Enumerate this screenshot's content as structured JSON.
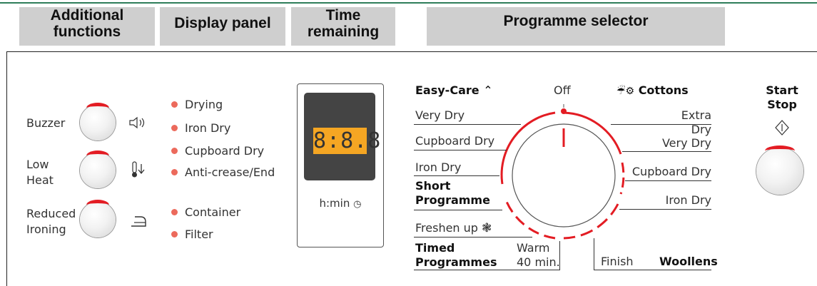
{
  "headers": {
    "additional_functions": [
      "Additional",
      "functions"
    ],
    "display_panel": "Display panel",
    "time_remaining": [
      "Time",
      "remaining"
    ],
    "programme_selector": "Programme selector"
  },
  "functions": [
    {
      "label": [
        "Buzzer"
      ],
      "icon": "speaker-icon"
    },
    {
      "label": [
        "Low",
        "Heat"
      ],
      "icon": "thermometer-down-icon"
    },
    {
      "label": [
        "Reduced",
        "Ironing"
      ],
      "icon": "iron-icon"
    }
  ],
  "indicators": [
    "Drying",
    "Iron Dry",
    "Cupboard Dry",
    "Anti-crease/End",
    "Container",
    "Filter"
  ],
  "display": {
    "digits": "8:8.8",
    "unit_label": "h:min"
  },
  "programmes": {
    "off": "Off",
    "easy_care": "Easy-Care",
    "cottons": "Cottons",
    "left": [
      "Very Dry",
      "Cupboard Dry",
      "Iron Dry"
    ],
    "short_programme": [
      "Short",
      "Programme"
    ],
    "freshen_up": "Freshen up",
    "timed_programmes": [
      "Timed",
      "Programmes"
    ],
    "warm": [
      "Warm",
      "40 min."
    ],
    "right": [
      "Extra Dry",
      "Very Dry",
      "Cupboard Dry",
      "Iron Dry"
    ],
    "finish": "Finish",
    "woollens": "Woollens"
  },
  "start_stop": [
    "Start",
    "Stop"
  ],
  "colors": {
    "accent_red": "#e31c23",
    "led": "#ec6a5c",
    "display_orange": "#f5a623",
    "header_grey": "#cfcfcf"
  }
}
